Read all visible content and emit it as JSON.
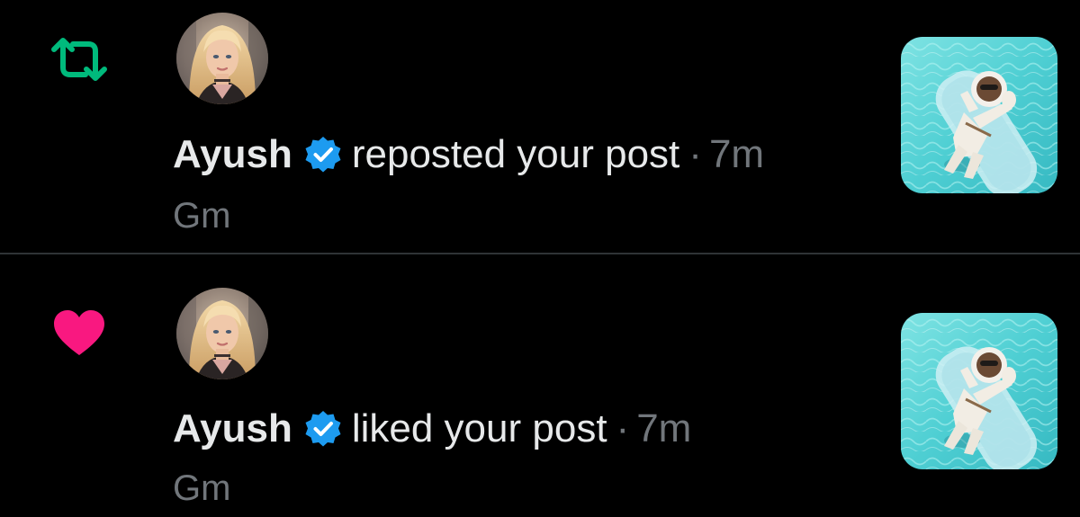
{
  "notifications": [
    {
      "type": "repost",
      "type_icon": "repost-icon",
      "icon_color": "#00ba7c",
      "user": "Ayush",
      "verified": true,
      "action": "reposted your post",
      "separator": "·",
      "time": "7m",
      "preview": "Gm"
    },
    {
      "type": "like",
      "type_icon": "heart-icon",
      "icon_color": "#f91880",
      "user": "Ayush",
      "verified": true,
      "action": "liked your post",
      "separator": "·",
      "time": "7m",
      "preview": "Gm"
    }
  ],
  "colors": {
    "background": "#000000",
    "primary_text": "#e7e9ea",
    "secondary_text": "#71767b",
    "verified_badge": "#1d9bf0",
    "divider": "#2f3336"
  }
}
